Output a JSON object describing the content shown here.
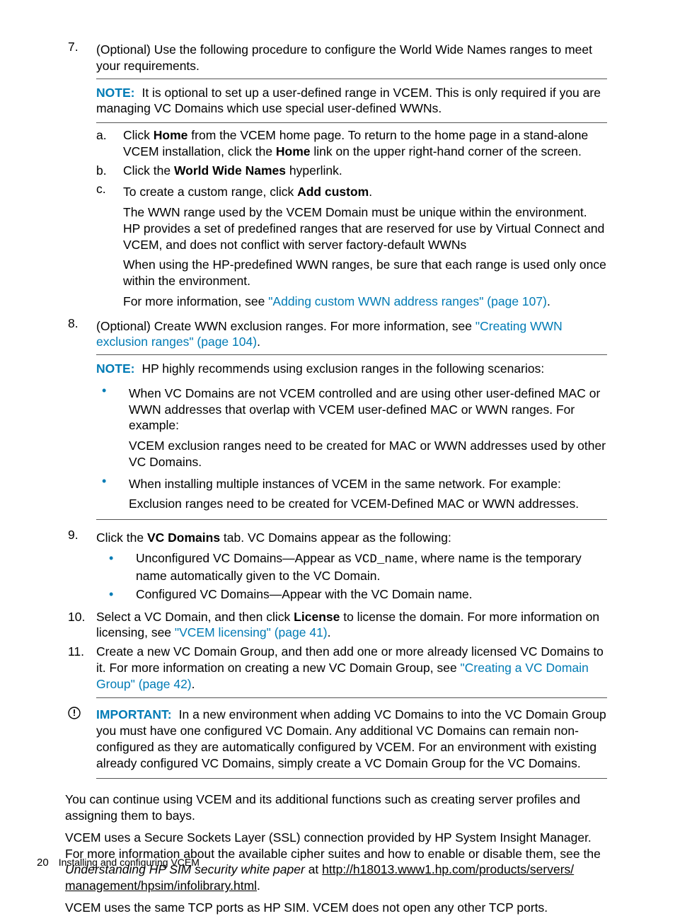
{
  "footer": {
    "page_num": "20",
    "title": "Installing and configuring VCEM"
  },
  "items": {
    "i7": {
      "num": "7.",
      "text_a": "(Optional) Use the following procedure to configure the World Wide Names ranges to meet your requirements.",
      "note_label": "NOTE:",
      "note_text": "It is optional to set up a user-defined range in VCEM. This is only required if you are managing VC Domains which use special user-defined WWNs.",
      "a": {
        "let": "a.",
        "t1": "Click ",
        "b1": "Home",
        "t2": " from the VCEM home page. To return to the home page in a stand-alone VCEM installation, click the ",
        "b2": "Home",
        "t3": " link on the upper right-hand corner of the screen."
      },
      "b": {
        "let": "b.",
        "t1": "Click the ",
        "b1": "World Wide Names",
        "t2": " hyperlink."
      },
      "c": {
        "let": "c.",
        "t1": "To create a custom range, click ",
        "b1": "Add custom",
        "t2": ".",
        "p1": "The WWN range used by the VCEM Domain must be unique within the environment. HP provides a set of predefined ranges that are reserved for use by Virtual Connect and VCEM, and does not conflict with server factory-default WWNs",
        "p2": "When using the HP-predefined WWN ranges, be sure that each range is used only once within the environment.",
        "p3a": "For more information, see ",
        "p3link": "\"Adding custom WWN address ranges\" (page 107)",
        "p3b": "."
      }
    },
    "i8": {
      "num": "8.",
      "t1": "(Optional) Create WWN exclusion ranges. For more information, see ",
      "link": "\"Creating WWN exclusion ranges\" (page 104)",
      "t2": ".",
      "note_label": "NOTE:",
      "note_text": "HP highly recommends using exclusion ranges in the following scenarios:",
      "bul1": {
        "p1": "When VC Domains are not VCEM controlled and are using other user-defined MAC or WWN addresses that overlap with VCEM user-defined MAC or WWN ranges. For example:",
        "p2": "VCEM exclusion ranges need to be created for MAC or WWN addresses used by other VC Domains."
      },
      "bul2": {
        "p1": "When installing multiple instances of VCEM in the same network. For example:",
        "p2": "Exclusion ranges need to be created for VCEM-Defined MAC or WWN addresses."
      }
    },
    "i9": {
      "num": "9.",
      "t1": "Click the ",
      "b1": "VC Domains",
      "t2": " tab. VC Domains appear as the following:",
      "bul1a": "Unconfigured VC Domains—Appear as ",
      "bul1code": "VCD_name",
      "bul1b": ", where name is the temporary name automatically given to the VC Domain.",
      "bul2": "Configured VC Domains—Appear with the VC Domain name."
    },
    "i10": {
      "num": "10.",
      "t1": "Select a VC Domain, and then click ",
      "b1": "License",
      "t2": " to license the domain. For more information on licensing, see ",
      "link": "\"VCEM licensing\" (page 41)",
      "t3": "."
    },
    "i11": {
      "num": "11.",
      "t1": "Create a new VC Domain Group, and then add one or more already licensed VC Domains to it. For more information on creating a new VC Domain Group, see ",
      "link": "\"Creating a VC Domain Group\" (page 42)",
      "t2": "."
    }
  },
  "important": {
    "label": "IMPORTANT:",
    "text": "In a new environment when adding VC Domains to into the VC Domain Group you must have one configured VC Domain. Any additional VC Domains can remain non-configured as they are automatically configured by VCEM. For an environment with existing already configured VC Domains, simply create a VC Domain Group for the VC Domains."
  },
  "closing": {
    "p1": "You can continue using VCEM and its additional functions such as creating server profiles and assigning them to bays.",
    "p2a": "VCEM uses a Secure Sockets Layer (SSL) connection provided by HP System Insight Manager. For more information about the available cipher suites and how to enable or disable them, see the ",
    "p2i": "Understanding HP SIM security white paper",
    "p2b": " at ",
    "p2link1": "http://h18013.www1.hp.com/products/servers/",
    "p2link2": "management/hpsim/infolibrary.html",
    "p2c": ".",
    "p3": "VCEM uses the same TCP ports as HP SIM. VCEM does not open any other TCP ports."
  }
}
